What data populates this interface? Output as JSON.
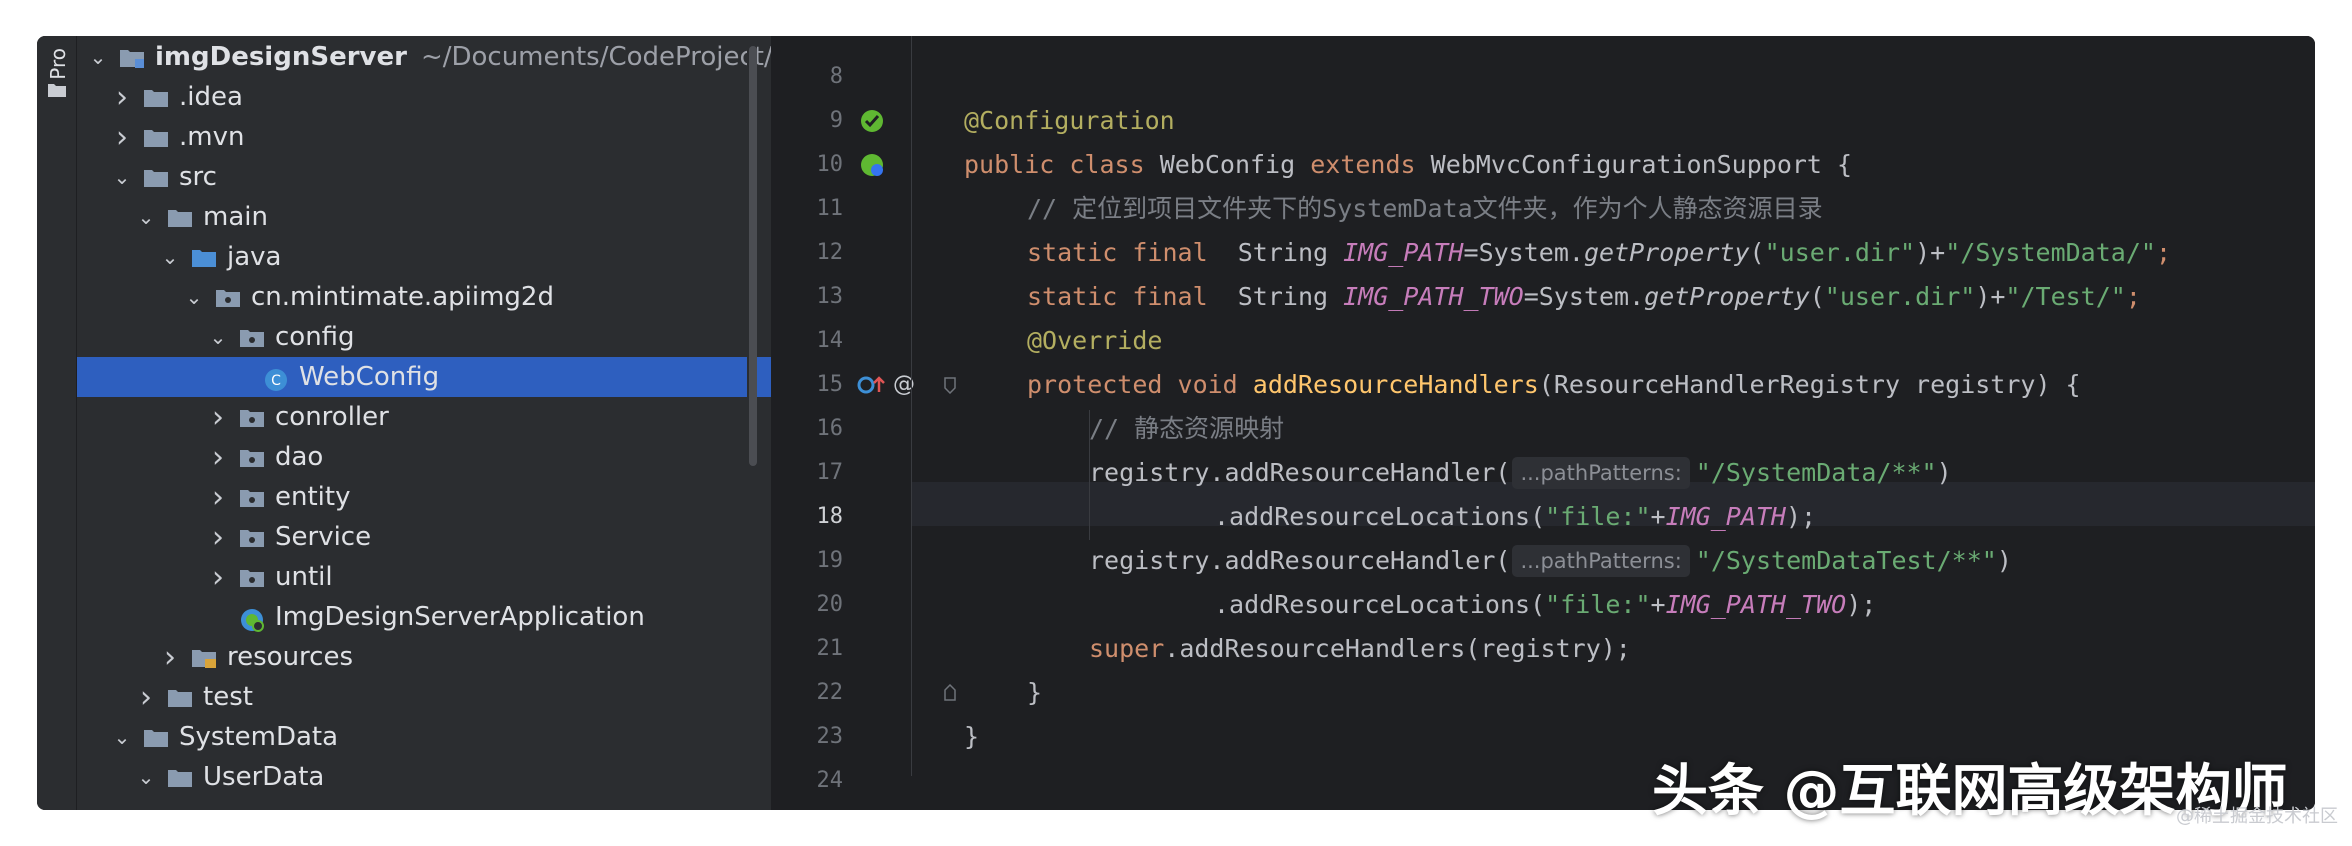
{
  "sidebar": {
    "panel_label": "Pro",
    "root": {
      "name": "imgDesignServer",
      "path": "~/Documents/CodeProject/"
    },
    "items": [
      {
        "label": ".idea",
        "depth": 1,
        "expanded": false,
        "icon": "folder-icon"
      },
      {
        "label": ".mvn",
        "depth": 1,
        "expanded": false,
        "icon": "folder-icon"
      },
      {
        "label": "src",
        "depth": 1,
        "expanded": true,
        "icon": "folder-icon"
      },
      {
        "label": "main",
        "depth": 2,
        "expanded": true,
        "icon": "folder-icon"
      },
      {
        "label": "java",
        "depth": 3,
        "expanded": true,
        "icon": "source-folder-icon"
      },
      {
        "label": "cn.mintimate.apiimg2d",
        "depth": 4,
        "expanded": true,
        "icon": "package-icon"
      },
      {
        "label": "config",
        "depth": 5,
        "expanded": true,
        "icon": "package-icon"
      },
      {
        "label": "WebConfig",
        "depth": 6,
        "expanded": null,
        "icon": "class-icon",
        "selected": true
      },
      {
        "label": "conroller",
        "depth": 5,
        "expanded": false,
        "icon": "package-icon"
      },
      {
        "label": "dao",
        "depth": 5,
        "expanded": false,
        "icon": "package-icon"
      },
      {
        "label": "entity",
        "depth": 5,
        "expanded": false,
        "icon": "package-icon"
      },
      {
        "label": "Service",
        "depth": 5,
        "expanded": false,
        "icon": "package-icon"
      },
      {
        "label": "until",
        "depth": 5,
        "expanded": false,
        "icon": "package-icon"
      },
      {
        "label": "ImgDesignServerApplication",
        "depth": 5,
        "expanded": null,
        "icon": "spring-boot-app-icon"
      },
      {
        "label": "resources",
        "depth": 3,
        "expanded": false,
        "icon": "resources-folder-icon"
      },
      {
        "label": "test",
        "depth": 2,
        "expanded": false,
        "icon": "folder-icon"
      },
      {
        "label": "SystemData",
        "depth": 1,
        "expanded": true,
        "icon": "folder-icon"
      },
      {
        "label": "UserData",
        "depth": 2,
        "expanded": true,
        "icon": "folder-icon"
      }
    ]
  },
  "editor": {
    "current_line": "18",
    "line_numbers": [
      "8",
      "9",
      "10",
      "11",
      "12",
      "13",
      "14",
      "15",
      "16",
      "17",
      "18",
      "19",
      "20",
      "21",
      "22",
      "23",
      "24"
    ],
    "hint_label": "...pathPatterns:",
    "code": {
      "l9_ann": "@Configuration",
      "l10_kw1": "public class",
      "l10_name": "WebConfig",
      "l10_kw2": "extends",
      "l10_super": "WebMvcConfigurationSupport {",
      "l11_cmt": "// 定位到项目文件夹下的SystemData文件夹，作为个人静态资源目录",
      "l12_kw": "static final",
      "l12_type": "String",
      "l12_const": "IMG_PATH",
      "l12_a": "=System.",
      "l12_fn": "getProperty",
      "l12_b": "(",
      "l12_str1": "\"user.dir\"",
      "l12_c": ")+",
      "l12_str2": "\"/SystemData/\"",
      "l12_d": ";",
      "l13_kw": "static final",
      "l13_type": "String",
      "l13_const": "IMG_PATH_TWO",
      "l13_a": "=System.",
      "l13_fn": "getProperty",
      "l13_b": "(",
      "l13_str1": "\"user.dir\"",
      "l13_c": ")+",
      "l13_str2": "\"/Test/\"",
      "l13_d": ";",
      "l14_ann": "@Override",
      "l15_kw": "protected void",
      "l15_fn": "addResourceHandlers",
      "l15_rest": "(ResourceHandlerRegistry registry) {",
      "l16_cmt": "// 静态资源映射",
      "l17_a": "registry.addResourceHandler(",
      "l17_str": "\"/SystemData/**\"",
      "l17_b": ")",
      "l18_a": ".addResourceLocations(",
      "l18_str": "\"file:\"",
      "l18_plus": "+",
      "l18_const": "IMG_PATH",
      "l18_b": ");",
      "l19_a": "registry.addResourceHandler(",
      "l19_str": "\"/SystemDataTest/**\"",
      "l19_b": ")",
      "l20_a": ".addResourceLocations(",
      "l20_str": "\"file:\"",
      "l20_plus": "+",
      "l20_const": "IMG_PATH_TWO",
      "l20_b": ");",
      "l21_kw": "super",
      "l21_rest": ".addResourceHandlers(registry);",
      "l22": "}",
      "l23": "}"
    }
  },
  "watermark": {
    "main": "头条 @互联网高级架构师",
    "sub": "@稀土掘金技术社区"
  },
  "colors": {
    "selection": "#2e5fbf",
    "keyword": "#cf8e6d",
    "string": "#6aab73",
    "annotation": "#b3ae60",
    "constant": "#c77dbb",
    "method_decl": "#ffc66d",
    "comment": "#7a7e85"
  }
}
